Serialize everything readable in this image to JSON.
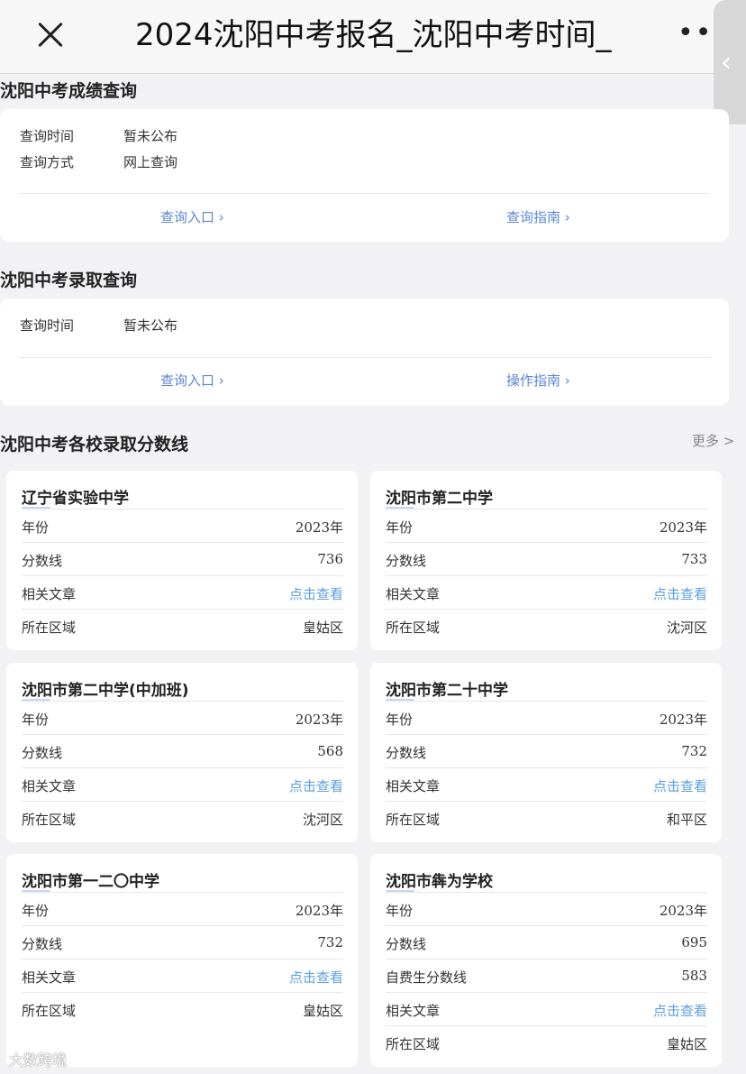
{
  "header": {
    "title": "2024沈阳中考报名_沈阳中考时间_",
    "more": "•••",
    "side_tab_chevron": "‹"
  },
  "score_query": {
    "title": "沈阳中考成绩查询",
    "rows": [
      {
        "label": "查询时间",
        "value": "暂未公布"
      },
      {
        "label": "查询方式",
        "value": "网上查询"
      }
    ],
    "entry_link": "查询入口 ›",
    "guide_link": "查询指南 ›"
  },
  "admission_query": {
    "title": "沈阳中考录取查询",
    "rows": [
      {
        "label": "查询时间",
        "value": "暂未公布"
      }
    ],
    "entry_link": "查询入口 ›",
    "guide_link": "操作指南 ›"
  },
  "cutoff": {
    "title": "沈阳中考各校录取分数线",
    "more": "更多 >",
    "schools": [
      {
        "name": "辽宁省实验中学",
        "rows": [
          {
            "label": "年份",
            "value": "2023年"
          },
          {
            "label": "分数线",
            "value": "736"
          },
          {
            "label": "相关文章",
            "value": "点击查看"
          },
          {
            "label": "所在区域",
            "value": "皇姑区"
          }
        ]
      },
      {
        "name": "沈阳市第二中学",
        "rows": [
          {
            "label": "年份",
            "value": "2023年"
          },
          {
            "label": "分数线",
            "value": "733"
          },
          {
            "label": "相关文章",
            "value": "点击查看"
          },
          {
            "label": "所在区域",
            "value": "沈河区"
          }
        ]
      },
      {
        "name": "沈阳市第二中学(中加班)",
        "rows": [
          {
            "label": "年份",
            "value": "2023年"
          },
          {
            "label": "分数线",
            "value": "568"
          },
          {
            "label": "相关文章",
            "value": "点击查看"
          },
          {
            "label": "所在区域",
            "value": "沈河区"
          }
        ]
      },
      {
        "name": "沈阳市第二十中学",
        "rows": [
          {
            "label": "年份",
            "value": "2023年"
          },
          {
            "label": "分数线",
            "value": "732"
          },
          {
            "label": "相关文章",
            "value": "点击查看"
          },
          {
            "label": "所在区域",
            "value": "和平区"
          }
        ]
      },
      {
        "name": "沈阳市第一二〇中学",
        "rows": [
          {
            "label": "年份",
            "value": "2023年"
          },
          {
            "label": "分数线",
            "value": "732"
          },
          {
            "label": "相关文章",
            "value": "点击查看"
          },
          {
            "label": "所在区域",
            "value": "皇姑区"
          }
        ]
      },
      {
        "name": "沈阳市犇为学校",
        "rows": [
          {
            "label": "年份",
            "value": "2023年"
          },
          {
            "label": "分数线",
            "value": "695"
          },
          {
            "label": "自费生分数线",
            "value": "583"
          },
          {
            "label": "相关文章",
            "value": "点击查看"
          },
          {
            "label": "所在区域",
            "value": "皇姑区"
          }
        ]
      }
    ]
  },
  "watermark": "大数跨境",
  "colors": {
    "link": "#5b86d6",
    "article_link": "#5b9fe0",
    "background": "#f2f2f4"
  }
}
